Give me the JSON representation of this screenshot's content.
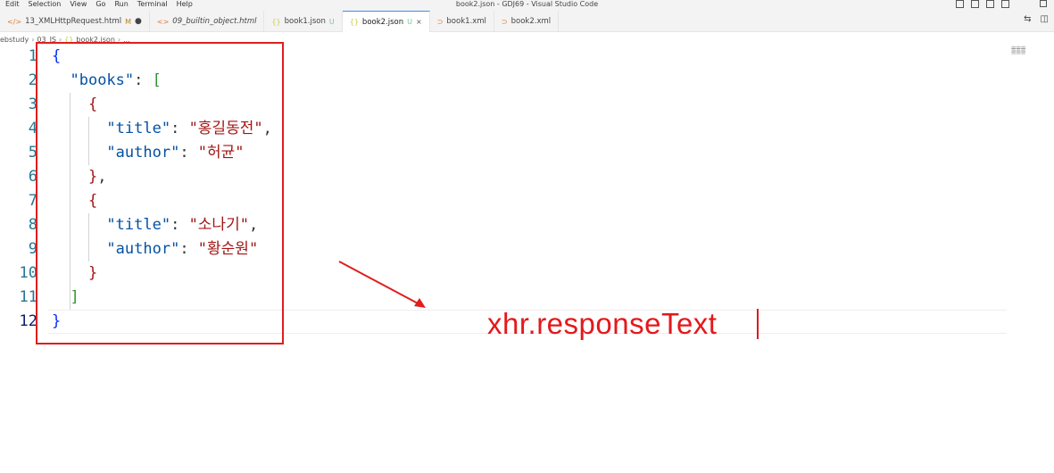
{
  "window": {
    "menu": [
      "Edit",
      "Selection",
      "View",
      "Go",
      "Run",
      "Terminal",
      "Help"
    ],
    "title": "book2.json - GDJ69 - Visual Studio Code"
  },
  "tabs": [
    {
      "icon": "html-file-icon",
      "label": "13_XMLHttpRequest.html",
      "status": "M",
      "dot": "●"
    },
    {
      "icon": "html-file-icon",
      "label": "09_builtin_object.html",
      "italic": true
    },
    {
      "icon": "json-file-icon",
      "label": "book1.json",
      "status": "U"
    },
    {
      "icon": "json-file-icon",
      "label": "book2.json",
      "status": "U",
      "close": "×",
      "active": true
    },
    {
      "icon": "xml-file-icon",
      "label": "book1.xml"
    },
    {
      "icon": "xml-file-icon",
      "label": "book2.xml"
    }
  ],
  "breadcrumb": [
    "ebstudy",
    "03_JS",
    "book2.json",
    "..."
  ],
  "editor": {
    "current_line": 12,
    "lines": [
      {
        "n": "1",
        "tokens": [
          {
            "t": "{",
            "c": "p"
          }
        ]
      },
      {
        "n": "2",
        "tokens": [
          {
            "t": "  ",
            "c": "pn"
          },
          {
            "t": "\"books\"",
            "c": "k"
          },
          {
            "t": ": ",
            "c": "pn"
          },
          {
            "t": "[",
            "c": "b"
          }
        ]
      },
      {
        "n": "3",
        "tokens": [
          {
            "t": "    ",
            "c": "pn"
          },
          {
            "t": "{",
            "c": "s"
          }
        ]
      },
      {
        "n": "4",
        "tokens": [
          {
            "t": "      ",
            "c": "pn"
          },
          {
            "t": "\"title\"",
            "c": "k"
          },
          {
            "t": ": ",
            "c": "pn"
          },
          {
            "t": "\"홍길동전\"",
            "c": "s"
          },
          {
            "t": ",",
            "c": "pn"
          }
        ]
      },
      {
        "n": "5",
        "tokens": [
          {
            "t": "      ",
            "c": "pn"
          },
          {
            "t": "\"author\"",
            "c": "k"
          },
          {
            "t": ": ",
            "c": "pn"
          },
          {
            "t": "\"허균\"",
            "c": "s"
          }
        ]
      },
      {
        "n": "6",
        "tokens": [
          {
            "t": "    ",
            "c": "pn"
          },
          {
            "t": "}",
            "c": "s"
          },
          {
            "t": ",",
            "c": "pn"
          }
        ]
      },
      {
        "n": "7",
        "tokens": [
          {
            "t": "    ",
            "c": "pn"
          },
          {
            "t": "{",
            "c": "s"
          }
        ]
      },
      {
        "n": "8",
        "tokens": [
          {
            "t": "      ",
            "c": "pn"
          },
          {
            "t": "\"title\"",
            "c": "k"
          },
          {
            "t": ": ",
            "c": "pn"
          },
          {
            "t": "\"소나기\"",
            "c": "s"
          },
          {
            "t": ",",
            "c": "pn"
          }
        ]
      },
      {
        "n": "9",
        "tokens": [
          {
            "t": "      ",
            "c": "pn"
          },
          {
            "t": "\"author\"",
            "c": "k"
          },
          {
            "t": ": ",
            "c": "pn"
          },
          {
            "t": "\"황순원\"",
            "c": "s"
          }
        ]
      },
      {
        "n": "10",
        "tokens": [
          {
            "t": "    ",
            "c": "pn"
          },
          {
            "t": "}",
            "c": "s"
          }
        ]
      },
      {
        "n": "11",
        "tokens": [
          {
            "t": "  ",
            "c": "pn"
          },
          {
            "t": "]",
            "c": "b"
          }
        ]
      },
      {
        "n": "12",
        "tokens": [
          {
            "t": "}",
            "c": "p"
          }
        ]
      }
    ]
  },
  "annotation": {
    "text": "xhr.responseText",
    "color": "#e3191b"
  }
}
